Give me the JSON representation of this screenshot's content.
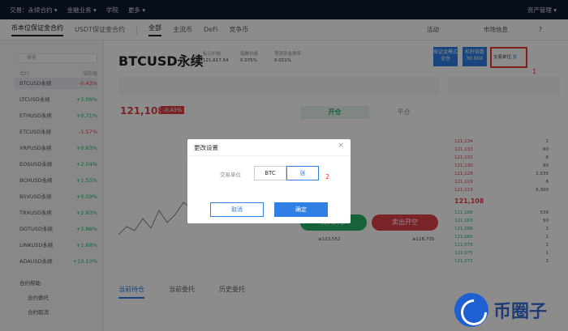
{
  "topnav": {
    "items": [
      "交易：永续合约 ▾",
      "金融业务 ▾",
      "学院",
      "更多 ▾"
    ],
    "right": "资产管理 ▾"
  },
  "tabs": {
    "items": [
      "币本位保证金合约",
      "USDT保证金合约"
    ],
    "filters": [
      "全部",
      "主流币",
      "DeFi",
      "竞争币"
    ],
    "right": [
      "活动",
      "市场信息"
    ]
  },
  "sidebar": {
    "search_placeholder": "搜索",
    "col_name": "合约",
    "col_change": "涨跌幅",
    "pairs": [
      {
        "name": "BTCUSD永续",
        "change": "-0.43%",
        "dir": "dn"
      },
      {
        "name": "LTCUSD永续",
        "change": "+3.06%",
        "dir": "up"
      },
      {
        "name": "ETHUSD永续",
        "change": "+0.71%",
        "dir": "up"
      },
      {
        "name": "ETCUSD永续",
        "change": "-1.57%",
        "dir": "dn"
      },
      {
        "name": "XRPUSD永续",
        "change": "+0.63%",
        "dir": "up"
      },
      {
        "name": "EOSUSD永续",
        "change": "+2.04%",
        "dir": "up"
      },
      {
        "name": "BCHUSD永续",
        "change": "+1.55%",
        "dir": "up"
      },
      {
        "name": "BSVUSD永续",
        "change": "+0.59%",
        "dir": "up"
      },
      {
        "name": "TRXUSD永续",
        "change": "+2.93%",
        "dir": "up"
      },
      {
        "name": "DOTUSD永续",
        "change": "+3.96%",
        "dir": "up"
      },
      {
        "name": "LINKUSD永续",
        "change": "+1.68%",
        "dir": "up"
      },
      {
        "name": "ADAUSD永续",
        "change": "+10.10%",
        "dir": "up"
      }
    ],
    "section": "合约帮助",
    "links": [
      "合约委托",
      "合约取消"
    ]
  },
  "header": {
    "title": "BTCUSD永续",
    "stats": [
      [
        "标记价格",
        "121,617.54"
      ],
      [
        "指数价格",
        "0.075%"
      ],
      [
        "预测资金费率",
        "0.051%"
      ]
    ],
    "btn_mode": "全仓",
    "btn_mode_label": "保证金模式",
    "btn_lev": "30.00X",
    "btn_lev_label": "杠杆倍数",
    "unit_label": "交易单位",
    "unit_value": "张",
    "annot1": "1"
  },
  "price": {
    "value": "121,108",
    "change": "-0.43%"
  },
  "order": {
    "tab_open": "开仓",
    "tab_close": "平仓",
    "buy": "买入开多",
    "sell": "卖出开空",
    "buy_price": "≤123,552",
    "sell_price": "≥118,735"
  },
  "orderbook": [
    {
      "p": "121,134",
      "q": "1"
    },
    {
      "p": "121,133",
      "q": "60"
    },
    {
      "p": "121,132",
      "q": "8"
    },
    {
      "p": "121,130",
      "q": "90"
    },
    {
      "p": "121,128",
      "q": "2,635"
    },
    {
      "p": "121,119",
      "q": "8"
    },
    {
      "p": "121,119",
      "q": "6,300"
    }
  ],
  "orderbook_mid": "121,108",
  "orderbook_bids": [
    {
      "p": "121,106",
      "q": "539"
    },
    {
      "p": "121,103",
      "q": "50"
    },
    {
      "p": "121,096",
      "q": "3"
    },
    {
      "p": "121,085",
      "q": "1"
    },
    {
      "p": "121,076",
      "q": "1"
    },
    {
      "p": "121,075",
      "q": "1"
    },
    {
      "p": "121,073",
      "q": "3"
    }
  ],
  "bottom": {
    "tabs": [
      "当前持仓",
      "当前委托",
      "历史委托"
    ]
  },
  "modal": {
    "title": "更改设置",
    "unit_label": "交易单位",
    "opt_btc": "BTC",
    "opt_zhang": "张",
    "annot2": "2",
    "cancel": "取消",
    "confirm": "确定"
  },
  "logo": {
    "text": "币圈子"
  }
}
